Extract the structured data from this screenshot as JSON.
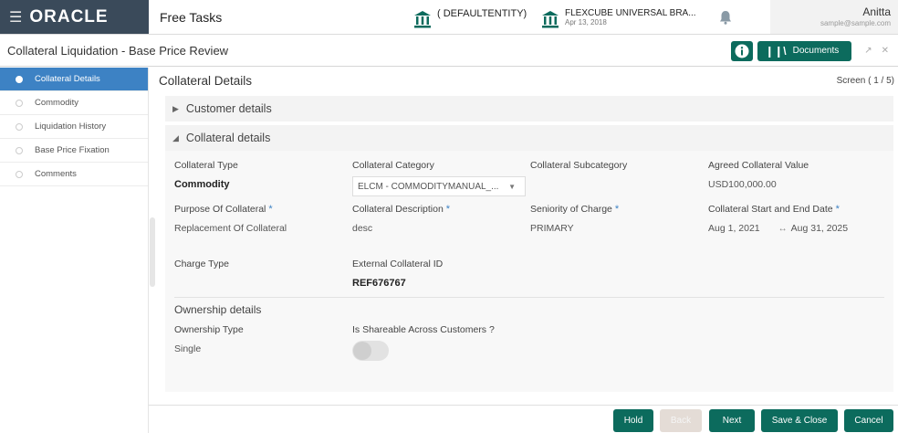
{
  "header": {
    "logo_text": "ORACLE",
    "menu_label": "Free Tasks",
    "entity1": "( DEFAULTENTITY)",
    "entity2_name": "FLEXCUBE UNIVERSAL BRA...",
    "entity2_date": "Apr 13, 2018",
    "user_name": "Anitta",
    "user_email": "sample@sample.com"
  },
  "titlebar": {
    "title": "Collateral Liquidation - Base Price Review",
    "documents_label": "Documents"
  },
  "sidebar": {
    "items": [
      {
        "label": "Collateral Details"
      },
      {
        "label": "Commodity"
      },
      {
        "label": "Liquidation History"
      },
      {
        "label": "Base Price Fixation"
      },
      {
        "label": "Comments"
      }
    ]
  },
  "main": {
    "title": "Collateral Details",
    "screen_count": "Screen ( 1 / 5)",
    "customer_section": "Customer details",
    "collateral_section": "Collateral details",
    "fields": {
      "collateral_type_label": "Collateral Type",
      "collateral_type_value": "Commodity",
      "collateral_category_label": "Collateral Category",
      "collateral_category_value": "ELCM - COMMODITYMANUAL_...",
      "collateral_subcategory_label": "Collateral Subcategory",
      "agreed_value_label": "Agreed Collateral Value",
      "agreed_value_value": "USD100,000.00",
      "purpose_label": "Purpose Of Collateral",
      "purpose_value": "Replacement Of Collateral",
      "description_label": "Collateral Description",
      "description_value": "desc",
      "seniority_label": "Seniority of Charge",
      "seniority_value": "PRIMARY",
      "date_label": "Collateral Start and End Date",
      "start_date": "Aug 1, 2021",
      "end_date": "Aug 31, 2025",
      "charge_type_label": "Charge Type",
      "external_id_label": "External Collateral ID",
      "external_id_value": "REF676767"
    },
    "ownership": {
      "title": "Ownership details",
      "type_label": "Ownership Type",
      "type_value": "Single",
      "shareable_label": "Is Shareable Across Customers ?",
      "shareable_value": false
    }
  },
  "footer": {
    "hold": "Hold",
    "back": "Back",
    "next": "Next",
    "save_close": "Save & Close",
    "cancel": "Cancel"
  },
  "colors": {
    "accent": "#3d82c4",
    "primary_button": "#0c6b5d",
    "disabled_button": "#e4dcd6",
    "brand_bar": "#3a4a5a"
  }
}
